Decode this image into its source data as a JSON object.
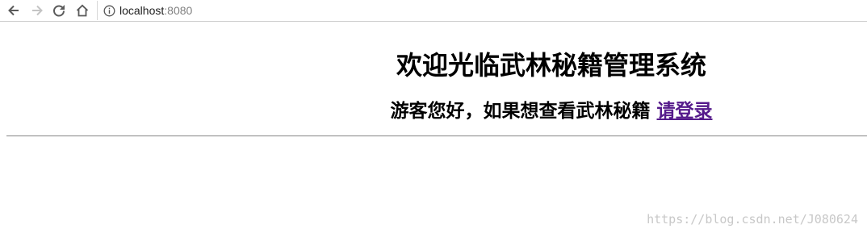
{
  "browser": {
    "url_host": "localhost",
    "url_port": ":8080"
  },
  "page": {
    "heading": "欢迎光临武林秘籍管理系统",
    "guest_prompt": "游客您好，如果想查看武林秘籍 ",
    "login_link": "请登录"
  },
  "watermark": "https://blog.csdn.net/J080624",
  "colors": {
    "link_visited": "#551a8b",
    "rule": "#9a9a9a"
  }
}
